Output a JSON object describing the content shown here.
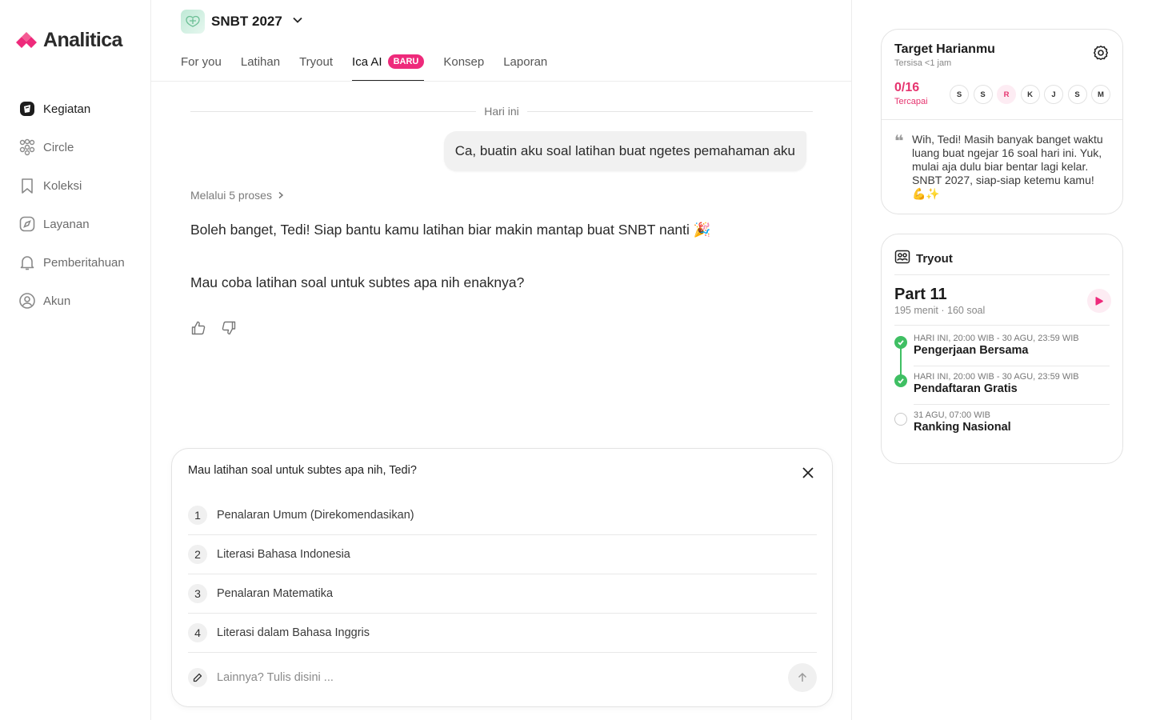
{
  "brand": {
    "name": "Analitica",
    "color": "#ee2a7b"
  },
  "sidebar": {
    "items": [
      {
        "label": "Kegiatan",
        "icon": "activity-icon",
        "active": true
      },
      {
        "label": "Circle",
        "icon": "people-icon"
      },
      {
        "label": "Koleksi",
        "icon": "bookmark-icon"
      },
      {
        "label": "Layanan",
        "icon": "compass-icon"
      },
      {
        "label": "Pemberitahuan",
        "icon": "bell-icon"
      },
      {
        "label": "Akun",
        "icon": "user-circle-icon"
      }
    ]
  },
  "header": {
    "program": "SNBT 2027",
    "tabs": [
      {
        "label": "For you"
      },
      {
        "label": "Latihan"
      },
      {
        "label": "Tryout"
      },
      {
        "label": "Ica AI",
        "badge": "BARU",
        "active": true
      },
      {
        "label": "Konsep"
      },
      {
        "label": "Laporan"
      }
    ]
  },
  "chat": {
    "day_label": "Hari ini",
    "user_message": "Ca, buatin aku soal latihan buat ngetes pemahaman aku",
    "process_label": "Melalui 5 proses",
    "ai_message_1": "Boleh banget, Tedi! Siap bantu kamu latihan biar makin mantap buat SNBT nanti 🎉",
    "ai_message_2": "Mau coba latihan soal untuk subtes apa nih enaknya?"
  },
  "question_panel": {
    "title": "Mau latihan soal untuk subtes apa nih, Tedi?",
    "options": [
      {
        "num": "1",
        "label": "Penalaran Umum (Direkomendasikan)"
      },
      {
        "num": "2",
        "label": "Literasi Bahasa Indonesia"
      },
      {
        "num": "3",
        "label": "Penalaran Matematika"
      },
      {
        "num": "4",
        "label": "Literasi dalam Bahasa Inggris"
      }
    ],
    "other_placeholder": "Lainnya? Tulis disini ..."
  },
  "target": {
    "title": "Target Harianmu",
    "subtitle": "Tersisa <1 jam",
    "count": "0/16",
    "count_label": "Tercapai",
    "days": [
      {
        "label": "S"
      },
      {
        "label": "S"
      },
      {
        "label": "R",
        "today": true
      },
      {
        "label": "K"
      },
      {
        "label": "J"
      },
      {
        "label": "S"
      },
      {
        "label": "M"
      }
    ],
    "quote": "Wih, Tedi! Masih banyak banget waktu luang buat ngejar 16 soal hari ini. Yuk, mulai aja dulu biar bentar lagi kelar. SNBT 2027, siap-siap ketemu kamu! 💪✨",
    "accent": "#e6346f"
  },
  "tryout": {
    "header": "Tryout",
    "part": "Part 11",
    "meta": "195 menit · 160 soal",
    "timeline": [
      {
        "date": "HARI INI, 20:00 WIB - 30 AGU, 23:59 WIB",
        "name": "Pengerjaan Bersama",
        "done": true
      },
      {
        "date": "HARI INI, 20:00 WIB - 30 AGU, 23:59 WIB",
        "name": "Pendaftaran Gratis",
        "done": true
      },
      {
        "date": "31 AGU, 07:00 WIB",
        "name": "Ranking Nasional",
        "done": false
      }
    ],
    "done_color": "#3fbf63"
  }
}
